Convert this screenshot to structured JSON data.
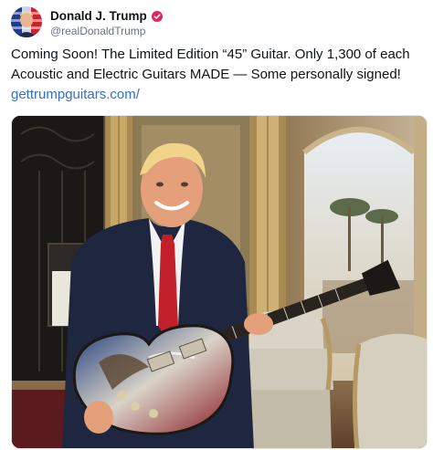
{
  "post": {
    "author": {
      "display_name": "Donald J. Trump",
      "handle": "@realDonaldTrump",
      "verified_icon": "verified-badge-icon",
      "verified_color": "#e0245e"
    },
    "text_lines": [
      "Coming Soon! The Limited Edition “45” Guitar. Only 1,300 of each",
      "Acoustic and Electric Guitars MADE — Some personally signed!"
    ],
    "link": "gettrumpguitars.com/",
    "colors": {
      "link": "#2f6fd0",
      "text": "#0f1419",
      "muted": "#6b7280"
    },
    "media": {
      "type": "photo"
    }
  }
}
